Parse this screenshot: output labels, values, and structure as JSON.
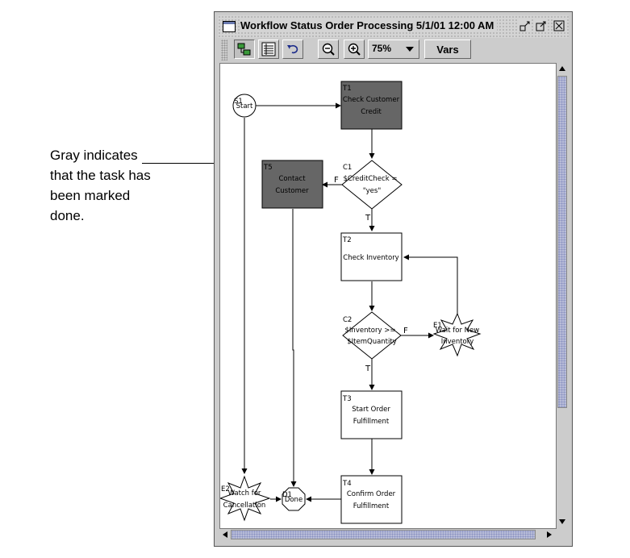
{
  "callout": {
    "line1": "Gray indicates",
    "line2": "that the task has",
    "line3": "been marked",
    "line4": "done."
  },
  "window": {
    "title": "Workflow Status Order Processing 5/1/01 12:00 AM",
    "controls": [
      "minimize-icon",
      "maximize-icon",
      "close-icon"
    ]
  },
  "toolbar": {
    "zoom_value": "75%",
    "vars_label": "Vars",
    "buttons": [
      "graph-view-icon",
      "list-view-icon",
      "undo-icon",
      "zoom-out-icon",
      "zoom-in-icon"
    ]
  },
  "diagram": {
    "done_color": "#666666",
    "nodes": {
      "s1": {
        "id": "S1",
        "label": "Start"
      },
      "t1": {
        "id": "T1",
        "line1": "Check Customer",
        "line2": "Credit",
        "done": true
      },
      "t5": {
        "id": "T5",
        "line1": "Contact",
        "line2": "Customer",
        "done": true
      },
      "c1": {
        "id": "C1",
        "line1": "$CreditCheck =",
        "line2": "\"yes\""
      },
      "t2": {
        "id": "T2",
        "line1": "Check Inventory"
      },
      "c2": {
        "id": "C2",
        "line1": "$Inventory >=",
        "line2": "$ItemQuantity"
      },
      "e1": {
        "id": "E1",
        "line1": "Wait for New",
        "line2": "Inventory"
      },
      "t3": {
        "id": "T3",
        "line1": "Start Order",
        "line2": "Fulfillment"
      },
      "t4": {
        "id": "T4",
        "line1": "Confirm Order",
        "line2": "Fulfillment"
      },
      "e2": {
        "id": "E2",
        "line1": "Watch for",
        "line2": "Cancellation"
      },
      "d1": {
        "id": "D1",
        "label": "Done"
      }
    },
    "edge_labels": {
      "c1_false": "F",
      "c1_true": "T",
      "c2_false": "F",
      "c2_true": "T"
    }
  }
}
